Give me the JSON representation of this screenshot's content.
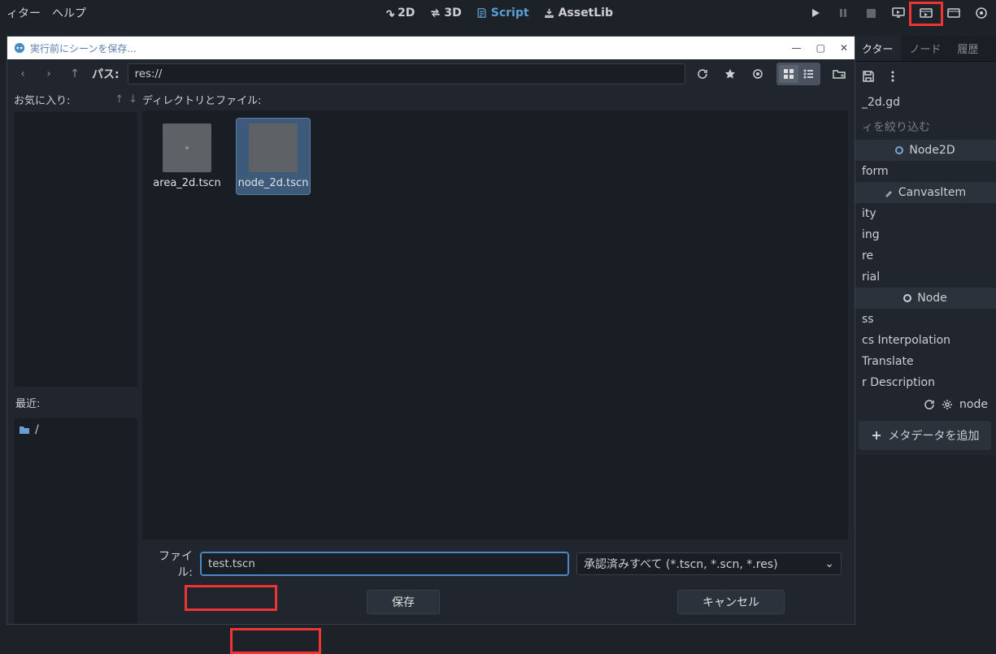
{
  "menu": {
    "editor": "ィター",
    "help": "ヘルプ"
  },
  "view": {
    "v2d": "2D",
    "v3d": "3D",
    "script": "Script",
    "assetlib": "AssetLib"
  },
  "inspector": {
    "tabs": {
      "inspector": "クター",
      "node": "ノード",
      "history": "履歴"
    },
    "file": "_2d.gd",
    "filter": "ィを絞り込む",
    "secNode2D": "Node2D",
    "rowTransform": "form",
    "secCanvas": "CanvasItem",
    "rowVisibility": "ity",
    "rowOrdering": "ing",
    "rowTexture": "re",
    "rowMaterial": "rial",
    "secNode": "Node",
    "rowProcess": "ss",
    "rowPhysics": "cs Interpolation",
    "rowAutoTranslate": "Translate",
    "rowDescription": "r Description",
    "metaLabel": "node",
    "addMeta": "メタデータを追加"
  },
  "dialog": {
    "title": "実行前にシーンを保存...",
    "pathLabel": "パス:",
    "path": "res://",
    "favLabel": "お気に入り:",
    "recentLabel": "最近:",
    "recentRoot": "/",
    "dirLabel": "ディレクトリとファイル:",
    "files": [
      {
        "name": "area_2d.tscn",
        "selected": false
      },
      {
        "name": "node_2d.tscn",
        "selected": true
      }
    ],
    "fileLabel": "ファイル:",
    "filename": "test.tscn",
    "filter": "承認済みすべて (*.tscn, *.scn, *.res)",
    "save": "保存",
    "cancel": "キャンセル"
  }
}
